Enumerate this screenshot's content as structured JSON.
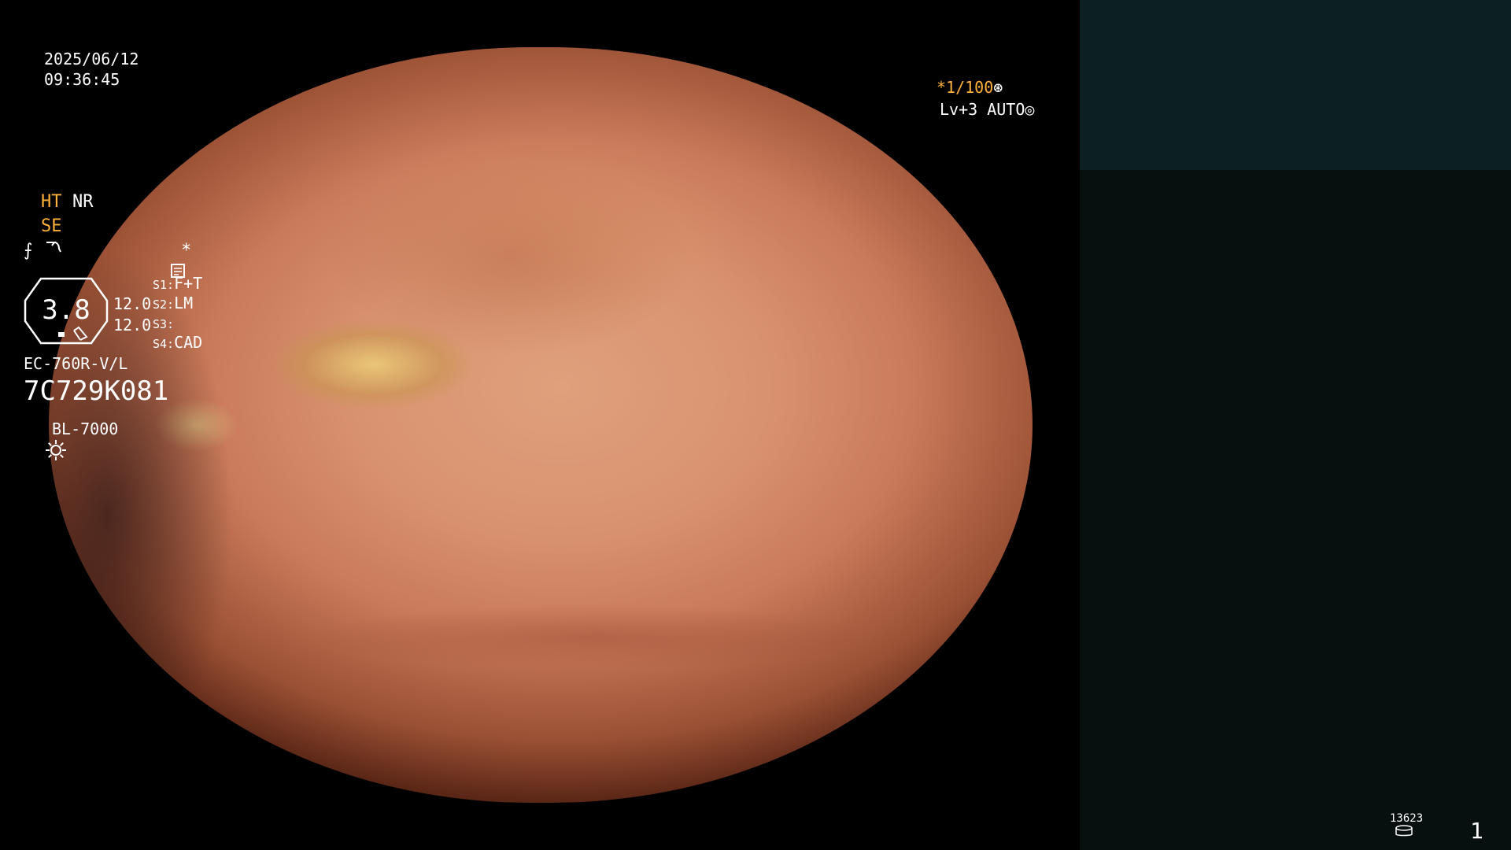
{
  "overlay": {
    "date": "2025/06/12",
    "time": "09:36:45",
    "shutter": "*1/100",
    "shutter_icon": "⊛",
    "level": "Lv+3 AUTO",
    "level_icon": "◎"
  },
  "panel": {
    "ht_label": "HT",
    "nr_label": "NR",
    "se_label": "SE",
    "scope_icon": "scope-icon",
    "f_icon": "⨍",
    "star": "*",
    "magnification": "3.8",
    "gain1": "12.0",
    "gain2": "12.0",
    "switches": [
      {
        "key": "S1:",
        "value": "F+T"
      },
      {
        "key": "S2:",
        "value": "LM"
      },
      {
        "key": "S3:",
        "value": ""
      },
      {
        "key": "S4:",
        "value": "CAD"
      }
    ],
    "scope_model": "EC-760R-V/L",
    "serial": "7C729K081",
    "lamp": "BL-7000"
  },
  "footer": {
    "record_count": "13623",
    "page": "1"
  },
  "colors": {
    "accent": "#ffb13a",
    "panel_bg": "#070f0f",
    "panel_top_bg": "#0c1f21"
  }
}
